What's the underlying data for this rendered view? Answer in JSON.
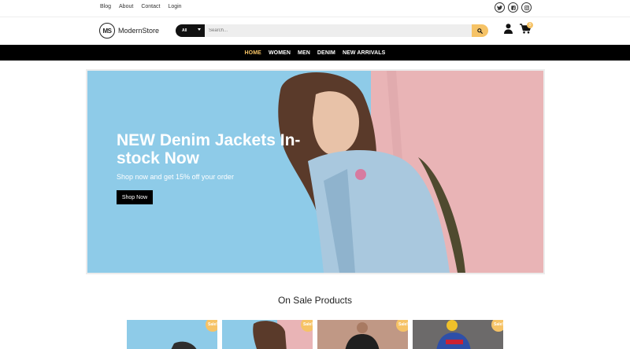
{
  "top_links": [
    "Blog",
    "About",
    "Contact",
    "Login"
  ],
  "social": [
    "twitter-icon",
    "facebook-icon",
    "instagram-icon"
  ],
  "brand": {
    "mark": "MS",
    "name": "ModernStore"
  },
  "search": {
    "category": "All",
    "placeholder": "Search..."
  },
  "cart": {
    "count": "0"
  },
  "nav": [
    "HOME",
    "WOMEN",
    "MEN",
    "DENIM",
    "NEW ARRIVALS"
  ],
  "hero": {
    "title": "NEW Denim Jackets In-stock Now",
    "subtitle": "Shop now and get 15% off your order",
    "button": "Shop Now"
  },
  "section_title": "On Sale Products",
  "products": [
    {
      "badge": "Sale!"
    },
    {
      "badge": "Sale!"
    },
    {
      "badge": "Sale!"
    },
    {
      "badge": "Sale!"
    }
  ],
  "colors": {
    "accent": "#f6c366",
    "nav_bg": "#000000",
    "hero_blue": "#8ecbe8",
    "hero_pink": "#e9b4b6"
  }
}
